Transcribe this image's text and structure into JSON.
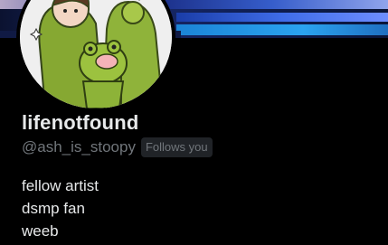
{
  "profile": {
    "display_name": "lifenotfound",
    "handle": "@ash_is_stoopy",
    "follows_badge": "Follows you",
    "bio_lines": [
      "fellow artist",
      "dsmp fan",
      "weeb"
    ]
  },
  "colors": {
    "background": "#000000",
    "primary_text": "#e7e9ea",
    "secondary_text": "#71767b",
    "badge_bg": "#202327"
  },
  "icons": {
    "avatar": "profile-avatar"
  }
}
